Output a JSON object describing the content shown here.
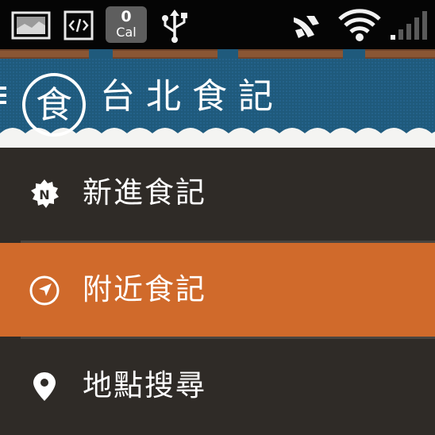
{
  "status_bar": {
    "calorie_count": "0",
    "calorie_unit": "Cal",
    "icons": [
      "gallery-icon",
      "code-icon",
      "usb-icon",
      "airplane-icon",
      "wifi-icon",
      "signal-icon"
    ]
  },
  "header": {
    "logo_char": "食",
    "title": "台北食記",
    "banner_color": "#1f5a7c",
    "wood_color": "#7a4a2c"
  },
  "menu": {
    "items": [
      {
        "label": "新進食記",
        "icon": "new-badge-icon",
        "badge_letter": "N",
        "active": false
      },
      {
        "label": "附近食記",
        "icon": "compass-icon",
        "active": true
      },
      {
        "label": "地點搜尋",
        "icon": "location-pin-icon",
        "active": false
      }
    ]
  },
  "colors": {
    "active_item": "#d06a2b",
    "menu_background": "#2f2b27",
    "status_bar": "#050505"
  }
}
